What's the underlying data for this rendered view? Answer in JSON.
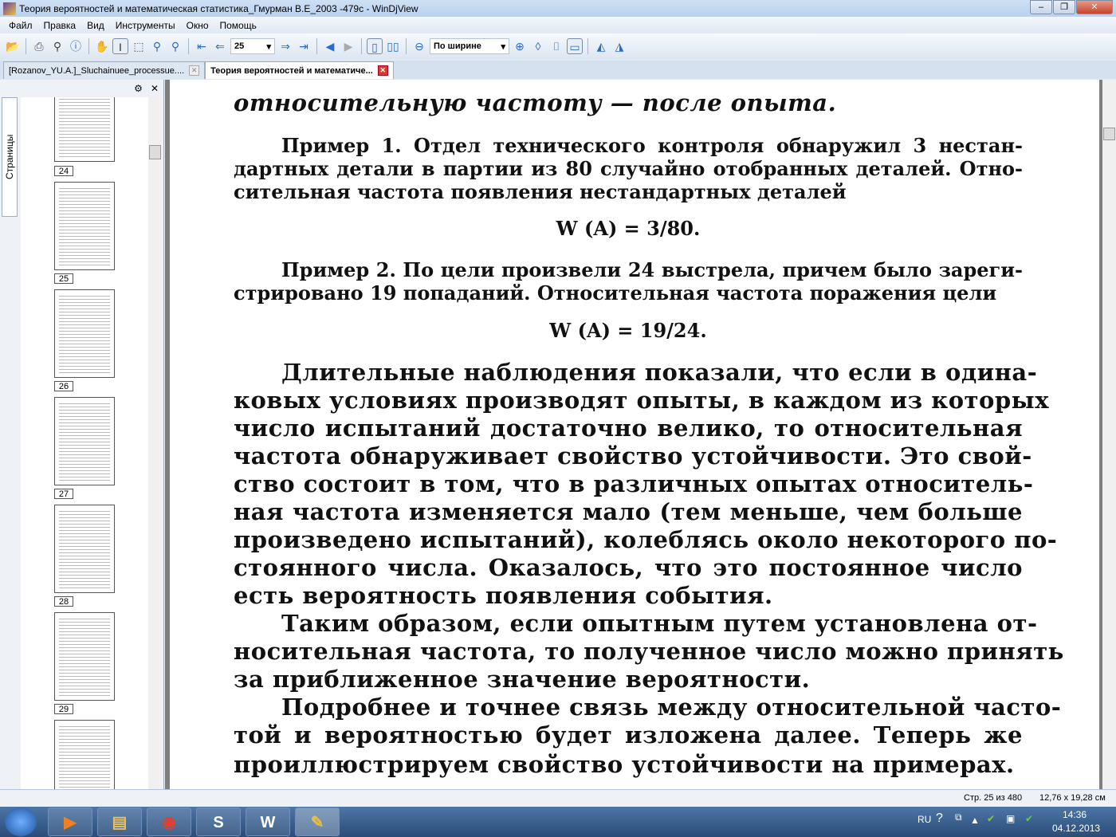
{
  "window": {
    "title": "Теория вероятностей и математическая статистика_Гмурман В.Е_2003 -479с - WinDjView"
  },
  "menu": [
    "Файл",
    "Правка",
    "Вид",
    "Инструменты",
    "Окно",
    "Помощь"
  ],
  "toolbar": {
    "page_value": "25",
    "zoom_value": "По ширине"
  },
  "tabs": [
    {
      "label": "[Rozanov_YU.A.]_Sluchainuee_processue...."
    },
    {
      "label": "Теория вероятностей и математиче..."
    }
  ],
  "sidebar": {
    "tab_label": "Страницы",
    "pages": [
      "24",
      "25",
      "26",
      "27",
      "28",
      "29"
    ]
  },
  "document": {
    "lines": [
      "относительную частоту — после опыта.",
      "Пример 1. Отдел технического контроля обнаружил 3 нестан-",
      "дартных детали в партии из 80 случайно отобранных деталей. Отно-",
      "сительная частота появления нестандартных деталей",
      "W (A) = 3/80.",
      "Пример 2. По цели произвели 24 выстрела, причем было зареги-",
      "стрировано 19 попаданий. Относительная частота поражения цели",
      "W (A) = 19/24.",
      "Длительные наблюдения показали, что если в одина-",
      "ковых условиях производят опыты, в каждом из которых",
      "число испытаний достаточно велико, то относительная",
      "частота обнаруживает свойство устойчивости. Это свой-",
      "ство состоит в том, что в различных опытах относитель-",
      "ная частота изменяется мало (тем меньше, чем больше",
      "произведено испытаний), колеблясь около некоторого по-",
      "стоянного числа. Оказалось, что это постоянное число",
      "есть вероятность появления события.",
      "Таким образом, если опытным путем установлена от-",
      "носительная частота, то полученное число можно принять",
      "за приближенное значение вероятности.",
      "Подробнее и точнее связь между относительной часто-",
      "той и вероятностью будет изложена далее. Теперь же",
      "проиллюстрируем свойство устойчивости на примерах."
    ]
  },
  "status": {
    "page": "Стр. 25 из 480",
    "size": "12,76 x 19,28 см"
  },
  "tray": {
    "lang": "RU",
    "time": "14:36",
    "date": "04.12.2013"
  }
}
